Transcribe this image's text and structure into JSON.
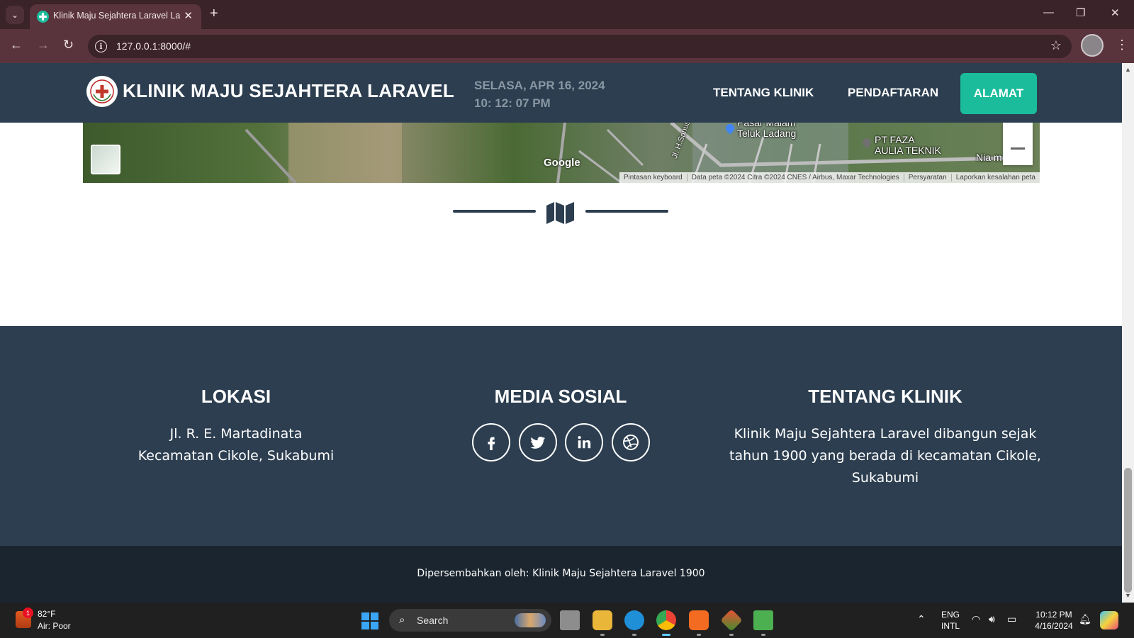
{
  "browser": {
    "tab_title": "Klinik Maju Sejahtera Laravel La",
    "url": "127.0.0.1:8000/#"
  },
  "header": {
    "brand": "KLINIK MAJU SEJAHTERA LARAVEL",
    "date": "SELASA, APR 16, 2024",
    "time": "10: 12: 07 PM",
    "nav": {
      "about": "TENTANG KLINIK",
      "register": "PENDAFTARAN",
      "address": "ALAMAT"
    },
    "colors": {
      "bar": "#2c3e50",
      "accent": "#1abc9c",
      "date": "#8a97a3"
    }
  },
  "map": {
    "google_label": "Google",
    "places": {
      "market": "Pasar Malam\nTeluk Ladang",
      "company": "PT FAZA\nAULIA TEKNIK",
      "road": "Jl. H.Sanusi",
      "edge": "Nia m"
    },
    "attribution": {
      "shortcuts": "Pintasan keyboard",
      "data": "Data peta ©2024 Citra ©2024 CNES / Airbus, Maxar Technologies",
      "terms": "Persyaratan",
      "report": "Laporkan kesalahan peta"
    }
  },
  "footer": {
    "location": {
      "title": "LOKASI",
      "line1": "Jl. R. E. Martadinata",
      "line2": "Kecamatan Cikole, Sukabumi"
    },
    "social": {
      "title": "MEDIA SOSIAL",
      "icons": [
        "facebook-icon",
        "twitter-icon",
        "linkedin-icon",
        "dribbble-icon"
      ]
    },
    "about": {
      "title": "TENTANG KLINIK",
      "line1": "Klinik Maju Sejahtera Laravel dibangun sejak",
      "line2": "tahun 1900 yang berada di kecamatan Cikole,",
      "line3": "Sukabumi"
    }
  },
  "copyright": {
    "text": "Dipersembahkan oleh: Klinik Maju Sejahtera Laravel 1900"
  },
  "taskbar": {
    "weather_temp": "82°F",
    "weather_cond": "Air: Poor",
    "weather_badge": "1",
    "search": "Search",
    "lang1": "ENG",
    "lang2": "INTL",
    "time": "10:12 PM",
    "date": "4/16/2024"
  }
}
